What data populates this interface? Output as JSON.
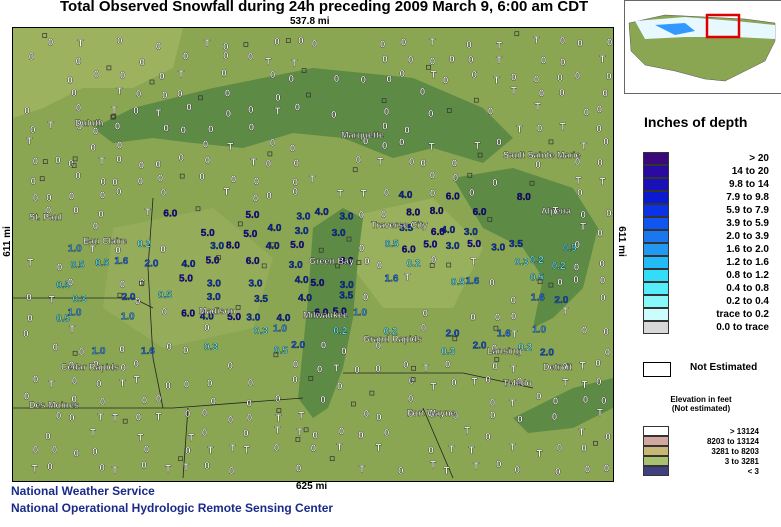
{
  "title": "Total Observed Snowfall during 24h preceding 2009 March 9, 6:00 am CDT",
  "scale": {
    "top": "537.8 mi",
    "bottom": "625 mi",
    "left": "611 mi",
    "right": "611 mi"
  },
  "cities": [
    "Duluth",
    "Marquette",
    "Sault Sainte Marie",
    "St. Paul",
    "Eau Claire",
    "Green Bay",
    "Traverse City",
    "Alpena",
    "Madison",
    "Milwaukee",
    "Grand Rapids",
    "Lansing",
    "Cedar Rapids",
    "Detroit",
    "Toledo",
    "Des Moines",
    "Fort Wayne"
  ],
  "observations": [
    {
      "t": "0",
      "c": "#ffffff"
    },
    {
      "t": "0",
      "c": "#ffffff"
    },
    {
      "t": "T",
      "c": "#ffffff"
    },
    {
      "t": "0",
      "c": "#ffffff"
    },
    {
      "t": "0",
      "c": "#ffffff"
    },
    {
      "t": "T",
      "c": "#ffffff"
    },
    {
      "t": "0",
      "c": "#ffffff"
    },
    {
      "t": "0",
      "c": "#ffffff"
    },
    {
      "t": "0.2",
      "c": "#66eeff"
    },
    {
      "t": "1.0",
      "c": "#3399ff"
    },
    {
      "t": "0.5",
      "c": "#55ddff"
    },
    {
      "t": "1.6",
      "c": "#2277ff"
    },
    {
      "t": "2.0",
      "c": "#1155ee"
    },
    {
      "t": "0.3",
      "c": "#66eeff"
    },
    {
      "t": "3.0",
      "c": "#0033cc"
    },
    {
      "t": "4.0",
      "c": "#0022bb"
    },
    {
      "t": "5.0",
      "c": "#1100bb"
    },
    {
      "t": "8.0",
      "c": "#110099"
    },
    {
      "t": "6.0",
      "c": "#1100aa"
    },
    {
      "t": "3.5",
      "c": "#0033cc"
    },
    {
      "t": "2.4",
      "c": "#1155ee"
    },
    {
      "t": "1.0",
      "c": "#3399ff"
    },
    {
      "t": "0.6",
      "c": "#55ddff"
    },
    {
      "t": "0.2",
      "c": "#66eeff"
    },
    {
      "t": "1.3",
      "c": "#33bbff"
    },
    {
      "t": "0.7",
      "c": "#55ddff"
    },
    {
      "t": "0.1",
      "c": "#aaffff"
    },
    {
      "t": "T",
      "c": "#ffffff"
    },
    {
      "t": "0",
      "c": "#ffffff"
    },
    {
      "t": "0",
      "c": "#ffffff"
    },
    {
      "t": "T",
      "c": "#ffffff"
    },
    {
      "t": "0",
      "c": "#ffffff"
    }
  ],
  "legend": {
    "title": "Inches of depth",
    "items": [
      {
        "label": ">  20",
        "color": "#3a0a7a"
      },
      {
        "label": "14 to  20",
        "color": "#2a0aa0"
      },
      {
        "label": "9.8 to  14",
        "color": "#1a10b8"
      },
      {
        "label": "7.9 to  9.8",
        "color": "#0a1ad0"
      },
      {
        "label": "5.9 to  7.9",
        "color": "#0a33e8"
      },
      {
        "label": "3.9 to  5.9",
        "color": "#1155f0"
      },
      {
        "label": "2.0 to  3.9",
        "color": "#1a77f0"
      },
      {
        "label": "1.6 to  2.0",
        "color": "#2299f0"
      },
      {
        "label": "1.2 to  1.6",
        "color": "#22bbf5"
      },
      {
        "label": "0.8 to  1.2",
        "color": "#33ddf8"
      },
      {
        "label": "0.4 to  0.8",
        "color": "#55eef8"
      },
      {
        "label": "0.2 to  0.4",
        "color": "#88f8fa"
      },
      {
        "label": "trace to  0.2",
        "color": "#ccfcfc"
      },
      {
        "label": "0.0 to trace",
        "color": "#d8d8d8"
      }
    ],
    "not_estimated": "Not Estimated"
  },
  "elevation": {
    "title_line1": "Elevation in feet",
    "title_line2": "(Not estimated)",
    "items": [
      {
        "label": ">  13124",
        "color": "#ffffff"
      },
      {
        "label": "8203 to  13124",
        "color": "#d0a8a0"
      },
      {
        "label": "3281 to   8203",
        "color": "#c8b878"
      },
      {
        "label": "3 to   3281",
        "color": "#a8c070"
      },
      {
        "label": "<   3",
        "color": "#404080"
      }
    ]
  },
  "footer": {
    "line1": "National Weather Service",
    "line2": "National Operational Hydrologic Remote Sensing Center"
  },
  "colors": {
    "land": "#8aa652",
    "land_high": "#9cb25e",
    "lake": "#5d8a44",
    "border": "#222222"
  }
}
